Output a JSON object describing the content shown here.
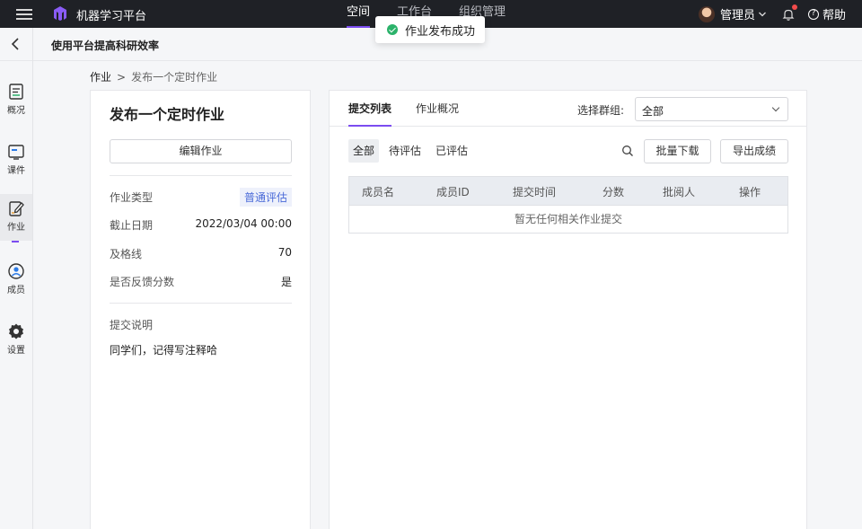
{
  "topbar": {
    "app_title": "机器学习平台",
    "nav": [
      {
        "label": "空间",
        "active": true
      },
      {
        "label": "工作台",
        "active": false
      },
      {
        "label": "组织管理",
        "active": false
      }
    ],
    "user_name": "管理员",
    "help_label": "帮助",
    "accent_color": "#7b4cf0"
  },
  "toast": {
    "message": "作业发布成功",
    "icon": "success-check-icon",
    "color": "#2bb26a"
  },
  "subheader": {
    "title": "使用平台提高科研效率"
  },
  "sidebar": {
    "items": [
      {
        "label": "概况",
        "icon": "overview-icon",
        "active": false
      },
      {
        "label": "课件",
        "icon": "courseware-icon",
        "active": false
      },
      {
        "label": "作业",
        "icon": "assignment-icon",
        "active": true
      },
      {
        "label": "成员",
        "icon": "members-icon",
        "active": false
      },
      {
        "label": "设置",
        "icon": "settings-icon",
        "active": false
      }
    ]
  },
  "breadcrumb": {
    "root": "作业",
    "separator": ">",
    "current": "发布一个定时作业"
  },
  "assignment": {
    "title": "发布一个定时作业",
    "edit_label": "编辑作业",
    "type_label": "作业类型",
    "type_value": "普通评估",
    "deadline_label": "截止日期",
    "deadline_value": "2022/03/04 00:00",
    "passline_label": "及格线",
    "passline_value": "70",
    "feedback_label": "是否反馈分数",
    "feedback_value": "是",
    "note_label": "提交说明",
    "note_text": "同学们，记得写注释哈"
  },
  "submissions": {
    "tabs": [
      {
        "label": "提交列表",
        "active": true
      },
      {
        "label": "作业概况",
        "active": false
      }
    ],
    "group_label": "选择群组:",
    "group_value": "全部",
    "filters": [
      {
        "label": "全部",
        "active": true
      },
      {
        "label": "待评估",
        "active": false
      },
      {
        "label": "已评估",
        "active": false
      }
    ],
    "download_label": "批量下载",
    "export_label": "导出成绩",
    "columns": [
      "成员名",
      "成员ID",
      "提交时间",
      "分数",
      "批阅人",
      "操作"
    ],
    "empty_text": "暂无任何相关作业提交"
  }
}
